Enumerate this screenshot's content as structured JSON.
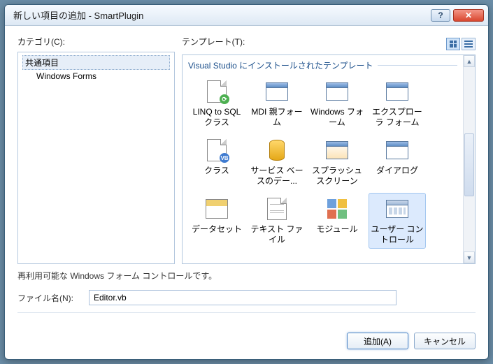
{
  "title": "新しい項目の追加 - SmartPlugin",
  "labels": {
    "category": "カテゴリ(C):",
    "templates": "テンプレート(T):",
    "group": "Visual Studio にインストールされたテンプレート",
    "description": "再利用可能な Windows フォーム コントロールです。",
    "filename": "ファイル名(N):",
    "add": "追加(A)",
    "cancel": "キャンセル"
  },
  "categories": {
    "root": "共通項目",
    "sub": "Windows Forms"
  },
  "templates": [
    {
      "name": "LINQ to SQL クラス",
      "icon": "linq"
    },
    {
      "name": "MDI 親フォーム",
      "icon": "form"
    },
    {
      "name": "Windows フォーム",
      "icon": "form"
    },
    {
      "name": "エクスプローラ フォーム",
      "icon": "form"
    },
    {
      "name": "クラス",
      "icon": "class"
    },
    {
      "name": "サービス ベースのデー...",
      "icon": "db"
    },
    {
      "name": "スプラッシュ スクリーン",
      "icon": "splash"
    },
    {
      "name": "ダイアログ",
      "icon": "form"
    },
    {
      "name": "データセット",
      "icon": "dataset"
    },
    {
      "name": "テキスト ファイル",
      "icon": "text"
    },
    {
      "name": "モジュール",
      "icon": "module"
    },
    {
      "name": "ユーザー コントロール",
      "icon": "uc",
      "selected": true
    }
  ],
  "filename_value": "Editor.vb"
}
